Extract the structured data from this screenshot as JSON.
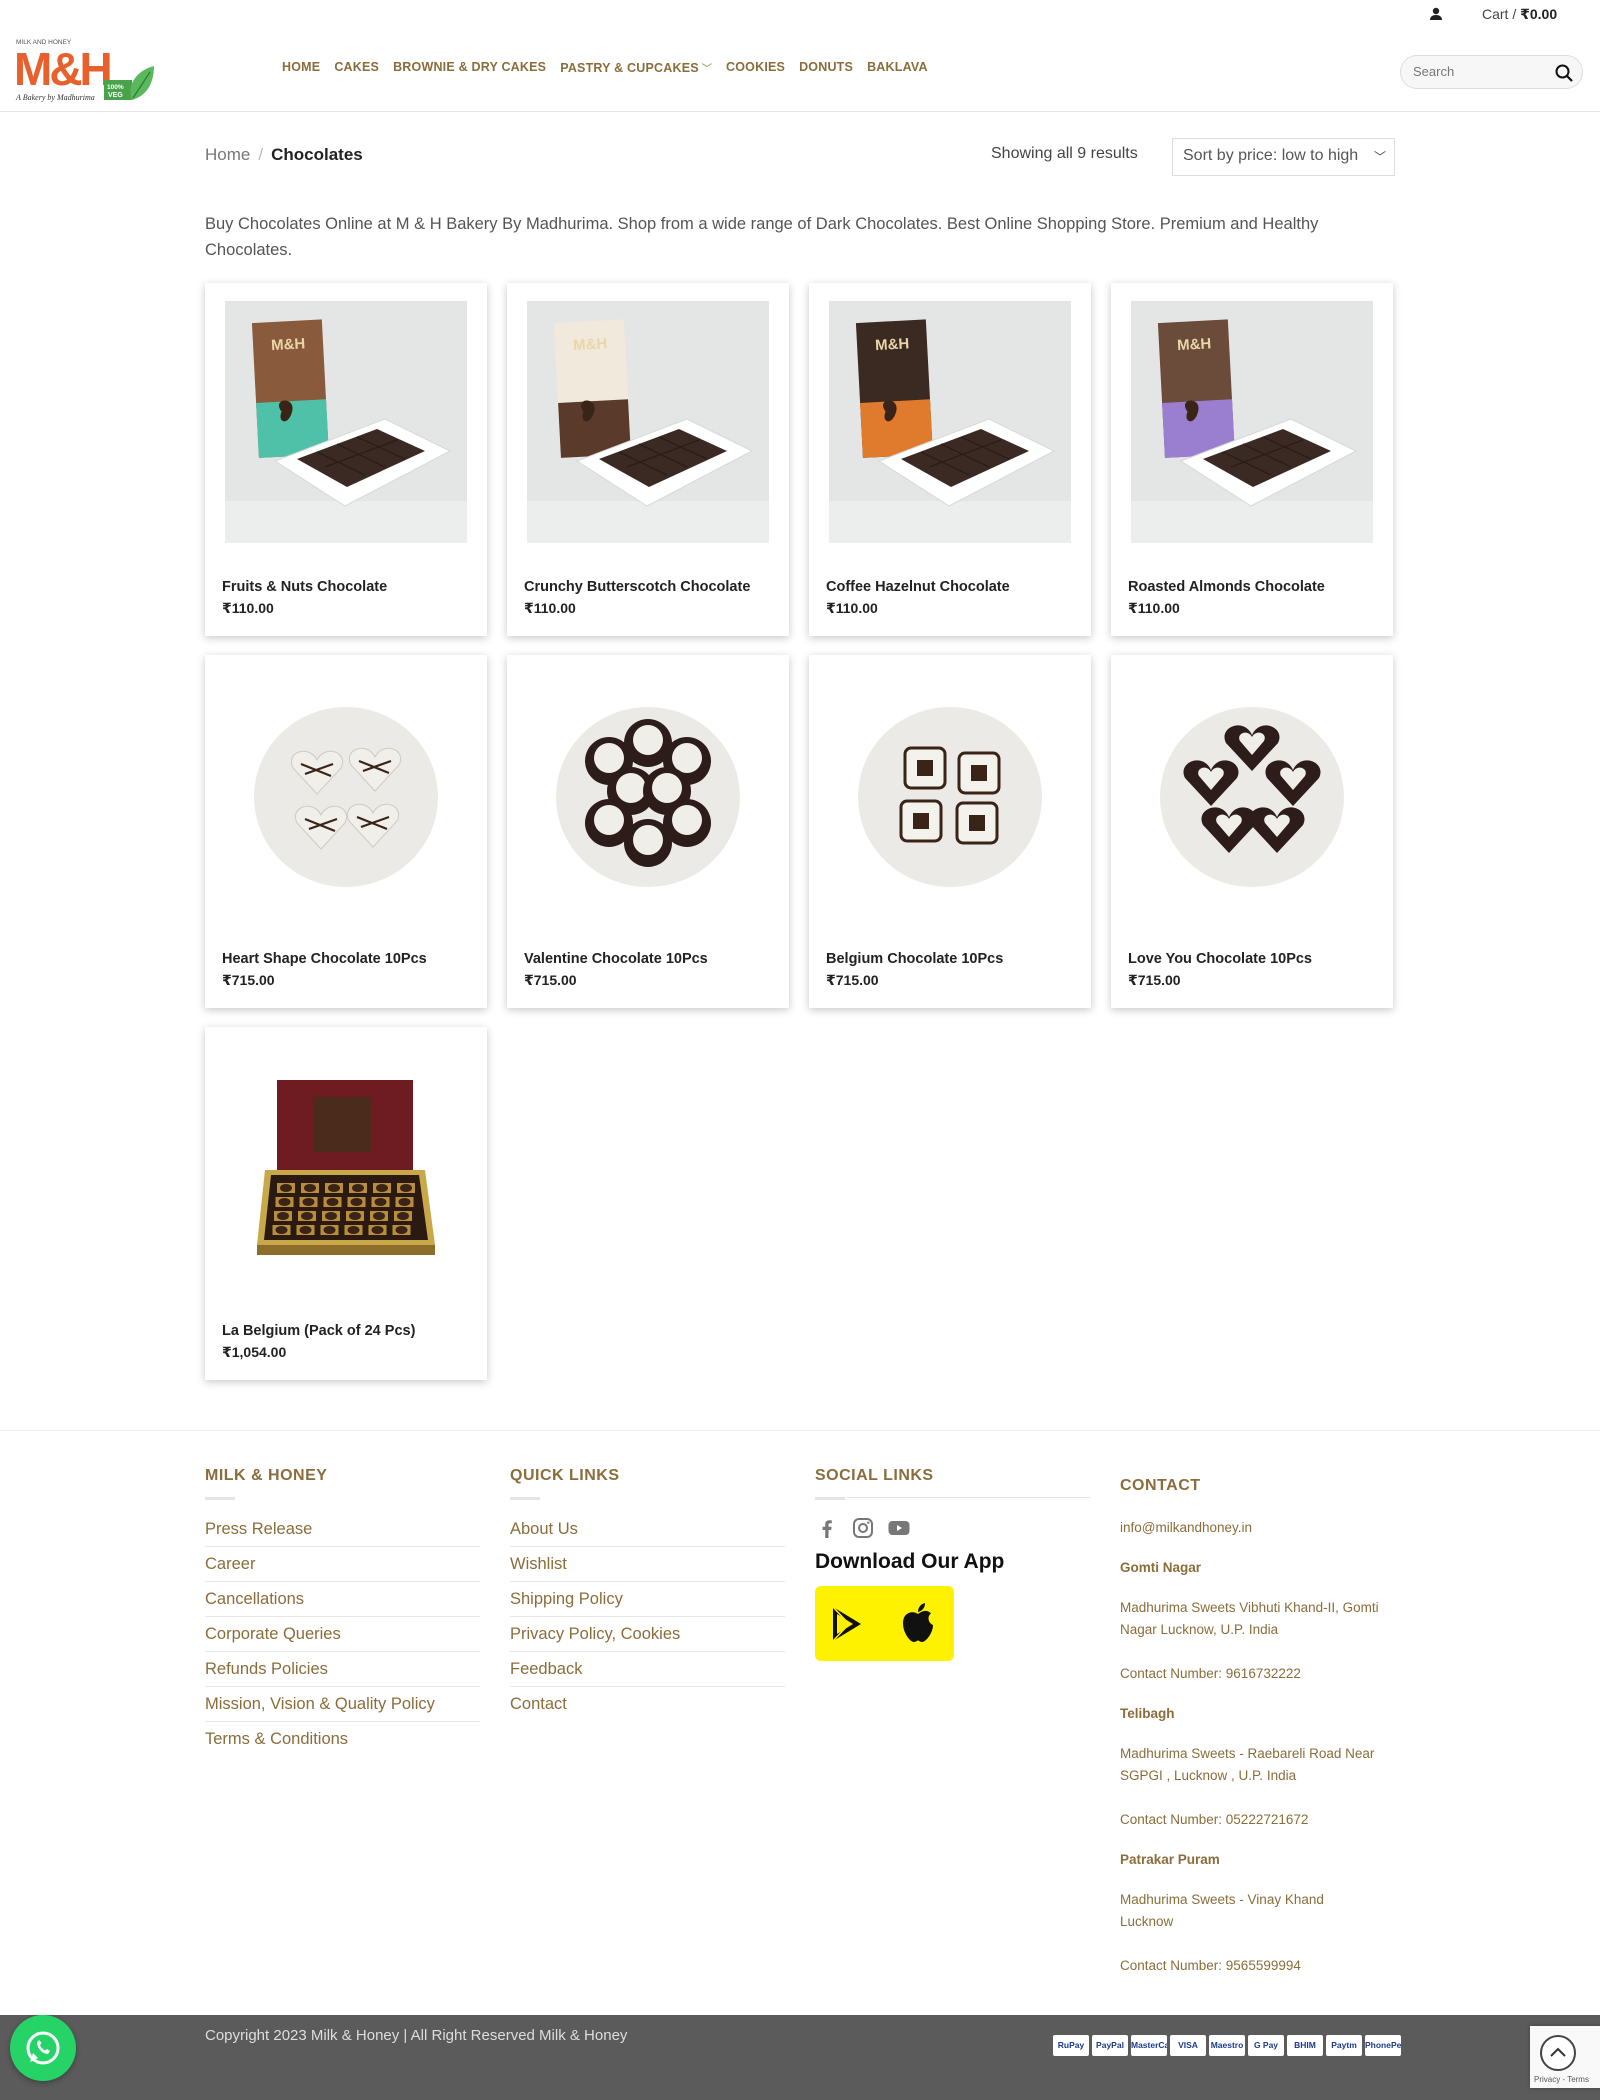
{
  "topbar": {
    "cart_label": "Cart /",
    "cart_total": "₹0.00"
  },
  "brand": {
    "top_text": "MILK AND HONEY",
    "monogram": "M&H",
    "tagline": "A Bakery by Madhurima",
    "veg_badge_line1": "100%",
    "veg_badge_line2": "VEG"
  },
  "nav": {
    "items": [
      {
        "label": "HOME"
      },
      {
        "label": "CAKES"
      },
      {
        "label": "BROWNIE & DRY CAKES"
      },
      {
        "label": "PASTRY & CUPCAKES"
      },
      {
        "label": "COOKIES"
      },
      {
        "label": "DONUTS"
      },
      {
        "label": "BAKLAVA"
      }
    ]
  },
  "search": {
    "placeholder": "Search"
  },
  "breadcrumb": {
    "home": "Home",
    "separator": "/",
    "current": "Chocolates"
  },
  "results": {
    "text": "Showing all 9 results"
  },
  "sort": {
    "selected": "Sort by price: low to high"
  },
  "description": "Buy Chocolates Online at M & H Bakery By Madhurima. Shop from a wide range of Dark Chocolates. Best Online Shopping Store. Premium and Healthy Chocolates.",
  "products": [
    {
      "name": "Fruits & Nuts Chocolate",
      "price": "₹110.00",
      "image": "bar",
      "box_color": "#8a5a3c",
      "box_accent": "#4fc1a8",
      "box_label": "M&H"
    },
    {
      "name": "Crunchy Butterscotch Chocolate",
      "price": "₹110.00",
      "image": "bar",
      "box_color": "#f1e9dc",
      "box_accent": "#5a3a2a",
      "box_label": "M&H"
    },
    {
      "name": "Coffee Hazelnut Chocolate",
      "price": "₹110.00",
      "image": "bar",
      "box_color": "#3b2a22",
      "box_accent": "#e07a2c",
      "box_label": "M&H"
    },
    {
      "name": "Roasted Almonds Chocolate",
      "price": "₹110.00",
      "image": "bar",
      "box_color": "#6b4b3a",
      "box_accent": "#9a7fd1",
      "box_label": "M&H"
    },
    {
      "name": "Heart Shape Chocolate 10Pcs",
      "price": "₹715.00",
      "image": "hearts-white"
    },
    {
      "name": "Valentine Chocolate 10Pcs",
      "price": "₹715.00",
      "image": "rounds"
    },
    {
      "name": "Belgium Chocolate 10Pcs",
      "price": "₹715.00",
      "image": "knots"
    },
    {
      "name": "Love You Chocolate 10Pcs",
      "price": "₹715.00",
      "image": "hearts-dark"
    },
    {
      "name": "La Belgium (Pack of 24 Pcs)",
      "price": "₹1,054.00",
      "image": "box"
    }
  ],
  "footer": {
    "col1": {
      "title": "MILK & HONEY",
      "links": [
        "Press Release",
        "Career",
        "Cancellations",
        "Corporate Queries",
        "Refunds Policies",
        "Mission, Vision & Quality Policy",
        "Terms & Conditions"
      ]
    },
    "col2": {
      "title": "QUICK LINKS",
      "links": [
        "About Us",
        "Wishlist",
        "Shipping Policy",
        "Privacy Policy, Cookies",
        "Feedback",
        "Contact"
      ]
    },
    "col3": {
      "title": "SOCIAL LINKS",
      "app_title": "Download Our App",
      "icons": [
        "facebook-icon",
        "instagram-icon",
        "youtube-icon"
      ]
    },
    "col4": {
      "title": "CONTACT",
      "email": "info@milkandhoney.in",
      "locations": [
        {
          "name": "Gomti Nagar",
          "address": "Madhurima Sweets Vibhuti Khand-II, Gomti Nagar Lucknow, U.P. India",
          "phone": "Contact Number: 9616732222"
        },
        {
          "name": "Telibagh",
          "address": "Madhurima Sweets - Raebareli Road Near SGPGI , Lucknow , U.P. India",
          "phone": "Contact Number: 05222721672"
        },
        {
          "name": "Patrakar Puram",
          "address": "Madhurima Sweets - Vinay Khand Lucknow",
          "phone": "Contact Number: 9565599994"
        }
      ]
    }
  },
  "bottombar": {
    "copyright": "Copyright 2023 Milk & Honey | All Right Reserved Milk & Honey",
    "payments": [
      "RuPay",
      "PayPal",
      "MasterCard",
      "VISA",
      "Maestro",
      "G Pay",
      "BHIM",
      "Paytm",
      "PhonePe"
    ]
  },
  "recaptcha": {
    "label": "Privacy - Terms"
  },
  "colors": {
    "nav": "#8a6d3b",
    "brand_orange": "#e8602c",
    "app_bg": "#fff200",
    "whatsapp": "#25d366",
    "bottombar": "#5b5b5b"
  }
}
